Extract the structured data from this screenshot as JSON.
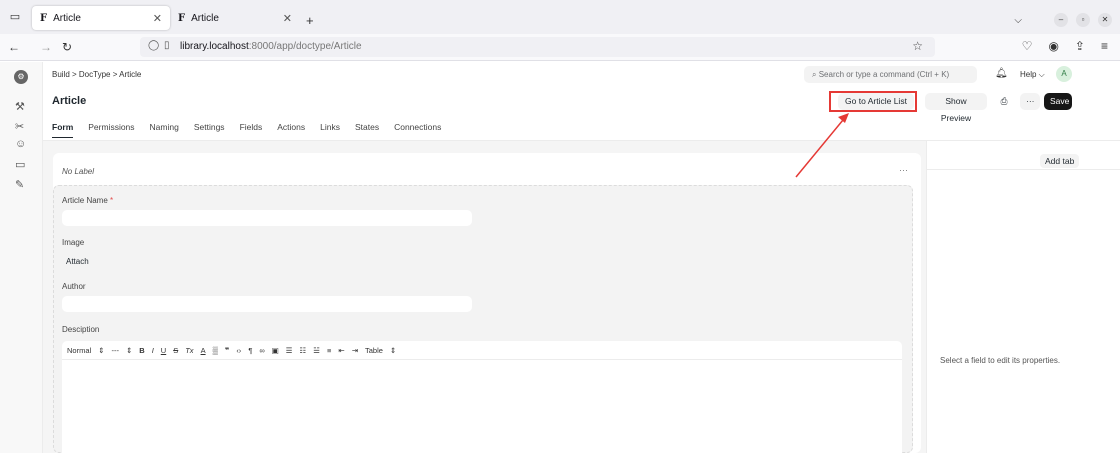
{
  "browser": {
    "tabs": [
      {
        "favicon": "F",
        "title": "Article"
      },
      {
        "favicon": "F",
        "title": "Article"
      }
    ],
    "new_tab": "+",
    "url_host": "library.localhost",
    "url_rest": ":8000/app/doctype/Article"
  },
  "header": {
    "breadcrumb": "Build  >  DocType  >  Article",
    "search_placeholder": "Search or type a command (Ctrl + K)",
    "help": "Help",
    "avatar_initial": "A",
    "page_title": "Article",
    "go_to_list": "Go to Article List",
    "show_preview": "Show Preview",
    "more": "···",
    "save": "Save"
  },
  "tabs": [
    "Form",
    "Permissions",
    "Naming",
    "Settings",
    "Fields",
    "Actions",
    "Links",
    "States",
    "Connections"
  ],
  "form": {
    "section_label": "No Label",
    "section_more": "···",
    "fields": {
      "article_name": "Article Name",
      "required_marker": "*",
      "image": "Image",
      "attach": "Attach",
      "author": "Author",
      "description": "Desciption"
    },
    "toolbar": {
      "style": "Normal",
      "size": "---",
      "table": "Table"
    }
  },
  "panel": {
    "add_tab": "Add tab",
    "empty_text": "Select a field to edit its properties."
  },
  "colors": {
    "annotation": "#e53935",
    "save_bg": "#171717"
  }
}
